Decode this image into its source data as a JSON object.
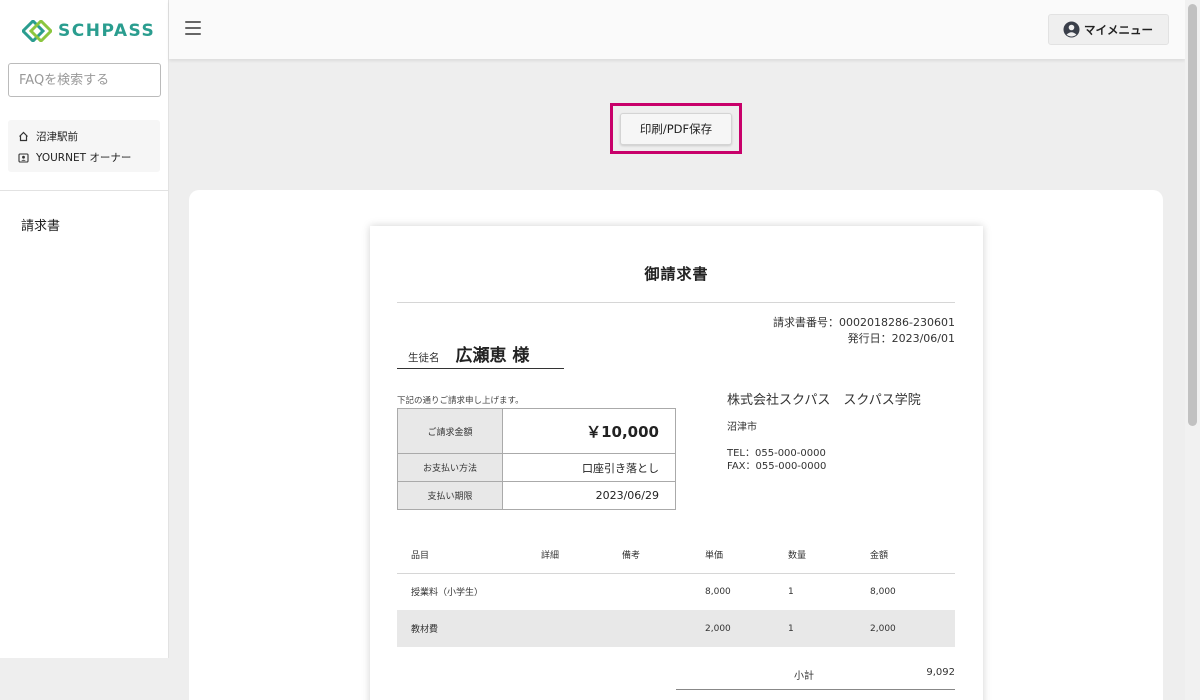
{
  "brand": {
    "name": "SCHPASS",
    "color": "#2a9d8f"
  },
  "sidebar": {
    "search_placeholder": "FAQを検索する",
    "org": {
      "school": "沼津駅前",
      "owner": "YOURNET オーナー"
    },
    "nav": [
      {
        "label": "請求書"
      }
    ]
  },
  "header": {
    "my_menu_label": "マイメニュー"
  },
  "toolbar": {
    "print_label": "印刷/PDF保存",
    "highlight_color": "#c8006a"
  },
  "invoice": {
    "title": "御請求書",
    "number_text": "請求書番号：0002018286-230601",
    "issue_text": "発行日：2023/06/01",
    "student_label": "生徒名",
    "student_name": "広瀬恵 様",
    "notice": "下記の通りご請求申し上げます。",
    "summary": [
      {
        "label": "ご請求金額",
        "value": "￥10,000"
      },
      {
        "label": "お支払い方法",
        "value": "口座引き落とし"
      },
      {
        "label": "支払い期限",
        "value": "2023/06/29"
      }
    ],
    "company": {
      "name": "株式会社スクパス　スクパス学院",
      "city": "沼津市",
      "tel": "TEL：055-000-0000",
      "fax": "FAX：055-000-0000"
    },
    "columns": [
      "品目",
      "詳細",
      "備考",
      "単価",
      "数量",
      "金額"
    ],
    "rows": [
      {
        "item": "授業料（小学生）",
        "detail": "",
        "note": "",
        "unit": "8,000",
        "qty": "1",
        "amount": "8,000"
      },
      {
        "item": "教材費",
        "detail": "",
        "note": "",
        "unit": "2,000",
        "qty": "1",
        "amount": "2,000"
      }
    ],
    "subtotal": {
      "label": "小計",
      "value": "9,092"
    }
  }
}
